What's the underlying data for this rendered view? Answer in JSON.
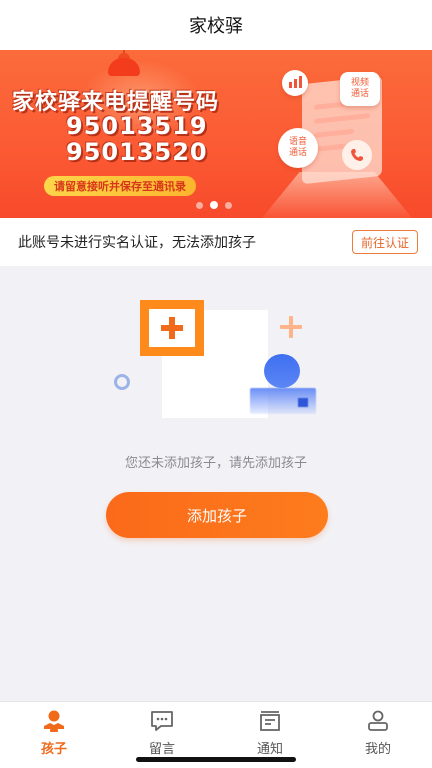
{
  "header": {
    "title": "家校驿"
  },
  "banner": {
    "line1": "家校驿来电提醒号码",
    "line2": "95013519",
    "line3": "95013520",
    "pill": "请留意接听并保存至通讯录",
    "video_bubble": "视频\n通话",
    "voice_bubble": "语音\n通话",
    "page_count": 3,
    "active_page": 2
  },
  "verify": {
    "message": "此账号未进行实名认证，无法添加孩子",
    "button": "前往认证"
  },
  "empty": {
    "text": "您还未添加孩子，请先添加孩子",
    "button": "添加孩子"
  },
  "tabs": [
    {
      "label": "孩子",
      "icon": "child-icon",
      "active": true
    },
    {
      "label": "留言",
      "icon": "message-icon",
      "active": false
    },
    {
      "label": "通知",
      "icon": "notice-icon",
      "active": false
    },
    {
      "label": "我的",
      "icon": "profile-icon",
      "active": false
    }
  ],
  "colors": {
    "accent": "#f06a1a",
    "banner": "#fb5a33",
    "page_bg": "#f2f2f6"
  }
}
